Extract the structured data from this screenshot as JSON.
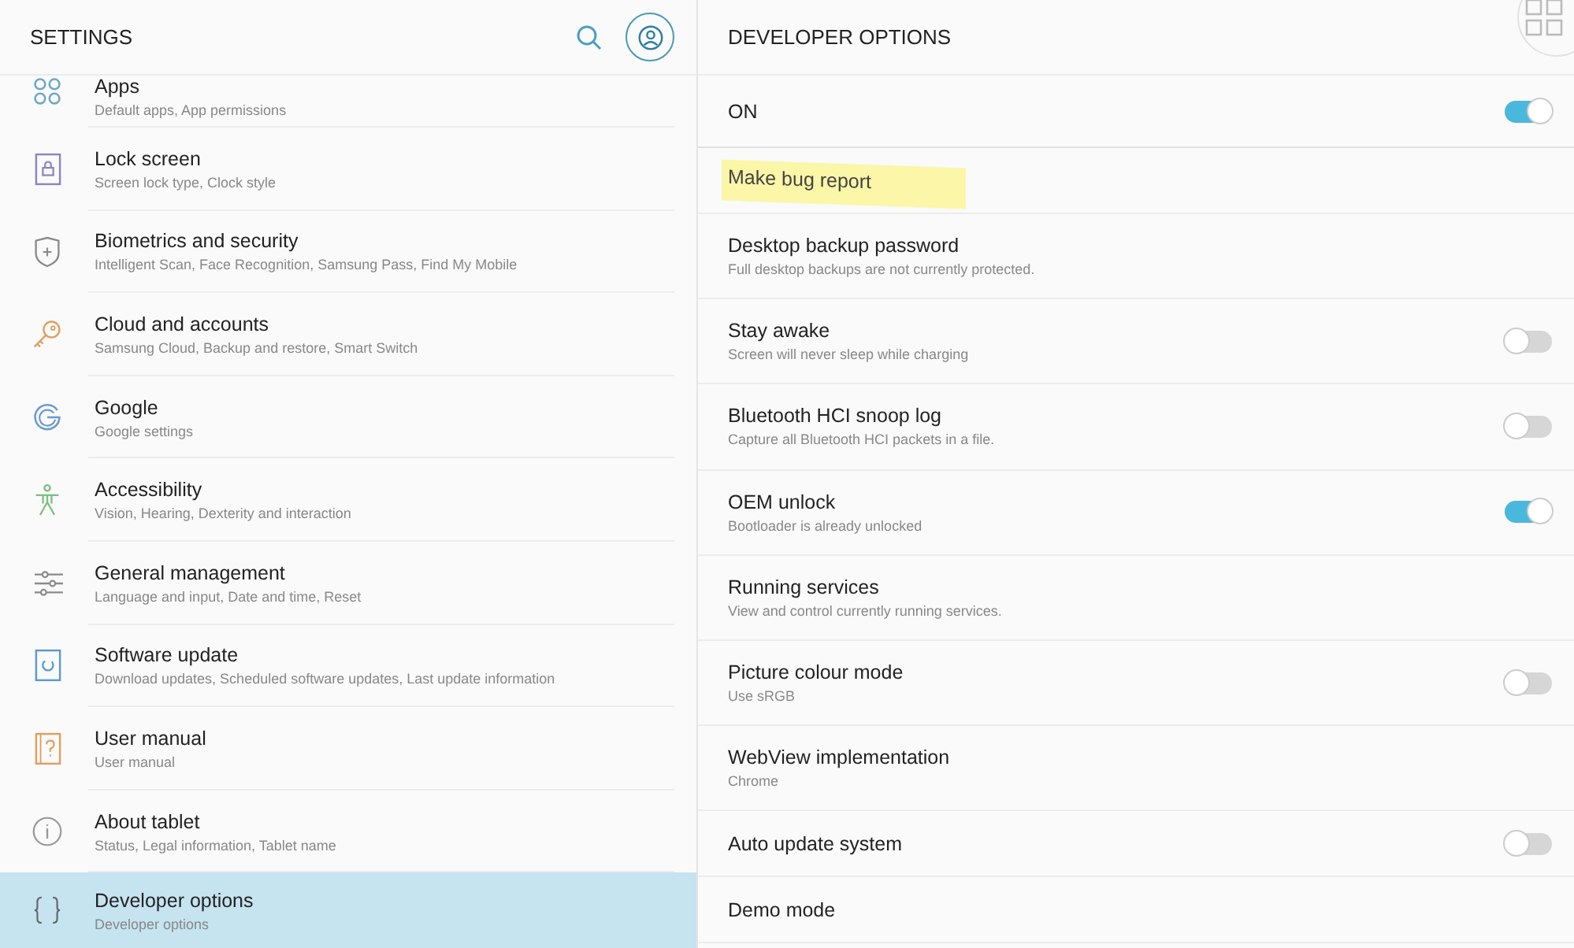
{
  "settings": {
    "title": "SETTINGS",
    "items": [
      {
        "title": "Apps",
        "subtitle": "Default apps, App permissions",
        "selected": false
      },
      {
        "title": "Lock screen",
        "subtitle": "Screen lock type, Clock style",
        "selected": false
      },
      {
        "title": "Biometrics and security",
        "subtitle": "Intelligent Scan, Face Recognition, Samsung Pass, Find My Mobile",
        "selected": false
      },
      {
        "title": "Cloud and accounts",
        "subtitle": "Samsung Cloud, Backup and restore, Smart Switch",
        "selected": false
      },
      {
        "title": "Google",
        "subtitle": "Google settings",
        "selected": false
      },
      {
        "title": "Accessibility",
        "subtitle": "Vision, Hearing, Dexterity and interaction",
        "selected": false
      },
      {
        "title": "General management",
        "subtitle": "Language and input, Date and time, Reset",
        "selected": false
      },
      {
        "title": "Software update",
        "subtitle": "Download updates, Scheduled software updates, Last update information",
        "selected": false
      },
      {
        "title": "User manual",
        "subtitle": "User manual",
        "selected": false
      },
      {
        "title": "About tablet",
        "subtitle": "Status, Legal information, Tablet name",
        "selected": false
      },
      {
        "title": "Developer options",
        "subtitle": "Developer options",
        "selected": true
      }
    ]
  },
  "developer_options": {
    "title": "DEVELOPER OPTIONS",
    "master": {
      "label": "ON",
      "on": true
    },
    "items": [
      {
        "kind": "plain",
        "title": "Make bug report",
        "highlighted": true
      },
      {
        "kind": "plain",
        "title": "Desktop backup password",
        "subtitle": "Full desktop backups are not currently protected."
      },
      {
        "kind": "toggle",
        "title": "Stay awake",
        "subtitle": "Screen will never sleep while charging",
        "on": false
      },
      {
        "kind": "toggle",
        "title": "Bluetooth HCI snoop log",
        "subtitle": "Capture all Bluetooth HCI packets in a file.",
        "on": false
      },
      {
        "kind": "toggle",
        "title": "OEM unlock",
        "subtitle": "Bootloader is already unlocked",
        "on": true
      },
      {
        "kind": "plain",
        "title": "Running services",
        "subtitle": "View and control currently running services."
      },
      {
        "kind": "toggle",
        "title": "Picture colour mode",
        "subtitle": "Use sRGB",
        "on": false
      },
      {
        "kind": "plain",
        "title": "WebView implementation",
        "subtitle": "Chrome"
      },
      {
        "kind": "toggle",
        "title": "Auto update system",
        "on": false
      },
      {
        "kind": "plain",
        "title": "Demo mode"
      }
    ]
  }
}
